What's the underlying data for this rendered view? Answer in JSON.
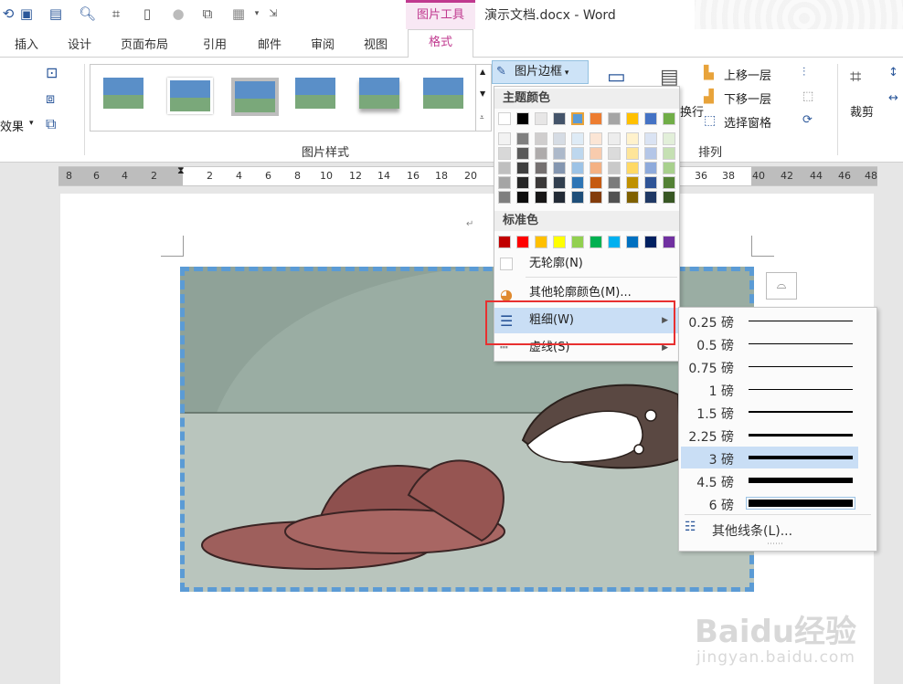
{
  "title_bar": {
    "tool_context": "图片工具",
    "document_title": "演示文档.docx - Word"
  },
  "tabs": [
    "插入",
    "设计",
    "页面布局",
    "引用",
    "邮件",
    "审阅",
    "视图",
    "格式"
  ],
  "ribbon": {
    "effects_label": "效果",
    "picture_styles_group": "图片样式",
    "picture_border_button": "图片边框",
    "wrap_text_partial": "换行",
    "bring_forward": "上移一层",
    "send_backward": "下移一层",
    "selection_pane": "选择窗格",
    "arrange_group": "排列",
    "crop": "裁剪"
  },
  "ruler": {
    "left_numbers": [
      "8",
      "6",
      "4",
      "2"
    ],
    "right_numbers": [
      "2",
      "4",
      "6",
      "8",
      "10",
      "12",
      "14",
      "16",
      "18",
      "20"
    ],
    "far_numbers": [
      "36",
      "38",
      "40",
      "42",
      "44",
      "46",
      "48"
    ]
  },
  "color_menu": {
    "theme_colors_header": "主题颜色",
    "theme_top_row": [
      "#ffffff",
      "#000000",
      "#e7e6e6",
      "#44546a",
      "#5b9bd5",
      "#ed7d31",
      "#a5a5a5",
      "#ffc000",
      "#4472c4",
      "#70ad47"
    ],
    "theme_shades": [
      [
        "#f2f2f2",
        "#7f7f7f",
        "#d0cece",
        "#d6dce4",
        "#deebf6",
        "#fbe5d5",
        "#ededed",
        "#fff2cc",
        "#dae3f3",
        "#e2efd9"
      ],
      [
        "#d8d8d8",
        "#595959",
        "#aeabab",
        "#adb9ca",
        "#bdd7ee",
        "#f8cbad",
        "#dbdbdb",
        "#fee599",
        "#b4c6e7",
        "#c5e0b3"
      ],
      [
        "#bfbfbf",
        "#3f3f3f",
        "#757070",
        "#8496b0",
        "#9dc3e6",
        "#f4b183",
        "#c9c9c9",
        "#ffd965",
        "#8eaadb",
        "#a8d08d"
      ],
      [
        "#a5a5a5",
        "#262626",
        "#3a3838",
        "#323f4f",
        "#2e75b5",
        "#c55a11",
        "#7b7b7b",
        "#bf9000",
        "#2f5496",
        "#538135"
      ],
      [
        "#7f7f7f",
        "#0c0c0c",
        "#171616",
        "#222a35",
        "#1e4e79",
        "#833c0b",
        "#525252",
        "#7f6000",
        "#1f3864",
        "#375623"
      ]
    ],
    "standard_colors_header": "标准色",
    "standard_colors": [
      "#c00000",
      "#ff0000",
      "#ffc000",
      "#ffff00",
      "#92d050",
      "#00b050",
      "#00b0f0",
      "#0070c0",
      "#002060",
      "#7030a0"
    ],
    "no_outline": "无轮廓(N)",
    "more_colors": "其他轮廓颜色(M)...",
    "weight": "粗细(W)",
    "dashes": "虚线(S)"
  },
  "weight_menu": {
    "items": [
      {
        "label": "0.25 磅",
        "weight_pt": 0.25
      },
      {
        "label": "0.5 磅",
        "weight_pt": 0.5
      },
      {
        "label": "0.75 磅",
        "weight_pt": 0.75
      },
      {
        "label": "1 磅",
        "weight_pt": 1
      },
      {
        "label": "1.5 磅",
        "weight_pt": 1.5
      },
      {
        "label": "2.25 磅",
        "weight_pt": 2.25
      },
      {
        "label": "3 磅",
        "weight_pt": 3
      },
      {
        "label": "4.5 磅",
        "weight_pt": 4.5
      },
      {
        "label": "6 磅",
        "weight_pt": 6
      }
    ],
    "selected_index": 6,
    "more_lines": "其他线条(L)..."
  },
  "colors": {
    "accent_context": "#c0398f",
    "border_dash": "#5b9bd5",
    "highlight": "#c9def5",
    "callout_red": "#e83030"
  },
  "watermark": {
    "brand": "Baidu经验",
    "url": "jingyan.baidu.com"
  }
}
